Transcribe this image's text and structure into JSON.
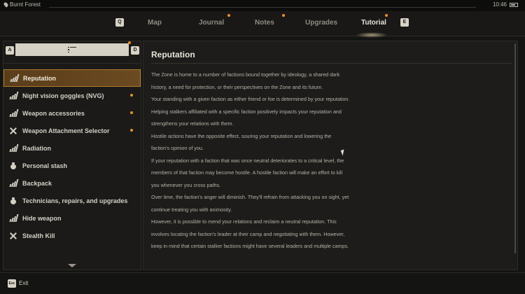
{
  "status": {
    "location": "Burnt Forest",
    "time": "10:46"
  },
  "tabs": {
    "left_key": "Q",
    "right_key": "E",
    "items": [
      {
        "label": "Map",
        "dot": false
      },
      {
        "label": "Journal",
        "dot": true
      },
      {
        "label": "Notes",
        "dot": true
      },
      {
        "label": "Upgrades",
        "dot": false
      },
      {
        "label": "Tutorial",
        "dot": true,
        "active": true
      }
    ]
  },
  "sidebar": {
    "left_key": "A",
    "right_key": "D",
    "items": [
      {
        "label": "Reputation",
        "icon": "signal-icon",
        "selected": true,
        "dot": false
      },
      {
        "label": "Night vision goggles (NVG)",
        "icon": "signal-icon",
        "dot": true
      },
      {
        "label": "Weapon accessories",
        "icon": "signal-icon",
        "dot": true
      },
      {
        "label": "Weapon Attachment Selector",
        "icon": "crossed-icon",
        "dot": true
      },
      {
        "label": "Radiation",
        "icon": "signal-icon",
        "dot": false
      },
      {
        "label": "Personal stash",
        "icon": "bag-icon",
        "dot": false
      },
      {
        "label": "Backpack",
        "icon": "signal-icon",
        "dot": false
      },
      {
        "label": "Technicians, repairs, and upgrades",
        "icon": "bag-icon",
        "dot": false
      },
      {
        "label": "Hide weapon",
        "icon": "signal-icon",
        "dot": false
      },
      {
        "label": "Stealth Kill",
        "icon": "crossed-icon",
        "dot": false
      }
    ]
  },
  "article": {
    "title": "Reputation",
    "lines": [
      "The Zone is home to a number of factions bound together by ideology, a shared dark",
      "history, a need for protection, or their perspectives on the Zone and its future.",
      "Your standing with a given faction as either friend or foe is determined by your reputation.",
      "Helping stalkers affiliated with a specific faction positively impacts your reputation and",
      "strengthens your relations with them.",
      "Hostile actions have the opposite effect, souring your reputation and lowering the",
      "faction's opinion of you.",
      "If your reputation with a faction that was once neutral deteriorates to a critical level, the",
      "members of that faction may become hostile. A hostile faction will make an effort to kill",
      "you whenever you cross paths.",
      "Over time, the faction's anger will diminish. They'll refrain from attacking you on sight, yet",
      "continue treating you with animosity.",
      "However, it is possible to mend your relations and reclaim a neutral reputation. This",
      "involves locating the faction's leader at their camp and negotiating with them. However,",
      "keep in mind that certain stalker factions might have several leaders and multiple camps."
    ]
  },
  "bottom": {
    "esc_key": "Esc",
    "exit_label": "Exit"
  },
  "colors": {
    "accent": "#e8902a",
    "selected_bg": "#6b4a20"
  }
}
